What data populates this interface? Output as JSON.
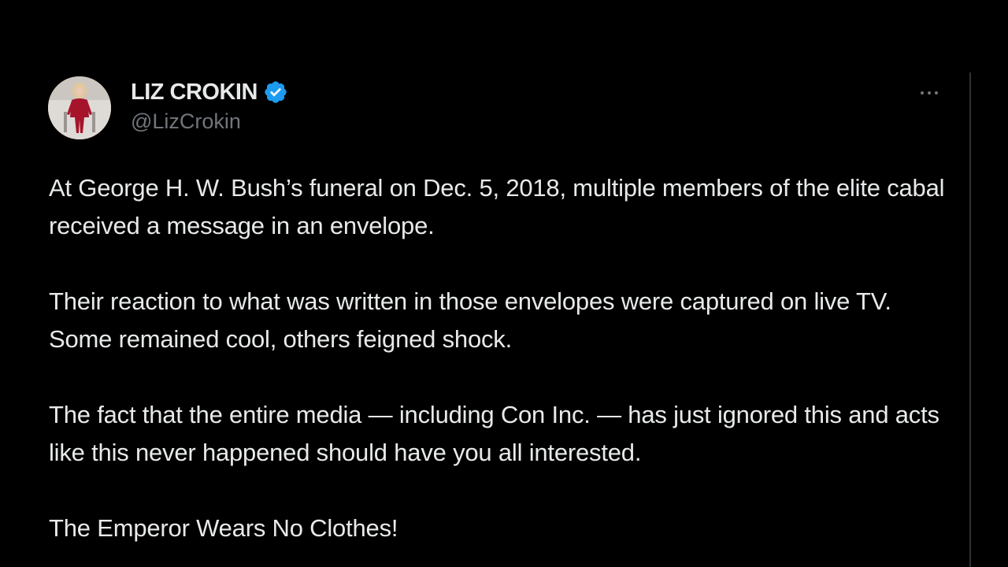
{
  "tweet": {
    "author": {
      "display_name": "LIZ CROKIN",
      "handle": "@LizCrokin",
      "verified": true,
      "avatar_icon": "profile-photo"
    },
    "more_icon": "ellipsis-icon",
    "paragraphs": [
      "At George H. W. Bush’s funeral on Dec. 5, 2018, multiple members of the elite cabal received a message in an envelope.",
      "Their reaction to what was written in those envelopes were captured on live TV. Some remained cool, others feigned shock.",
      "The fact that the entire media — including Con Inc. — has just ignored this and acts like this never happened should have you all interested.",
      "The Emperor Wears No Clothes!"
    ]
  },
  "colors": {
    "background": "#000000",
    "text_primary": "#e7e9ea",
    "text_secondary": "#71767b",
    "verified_blue": "#1d9bf0",
    "divider": "#2f3336"
  }
}
